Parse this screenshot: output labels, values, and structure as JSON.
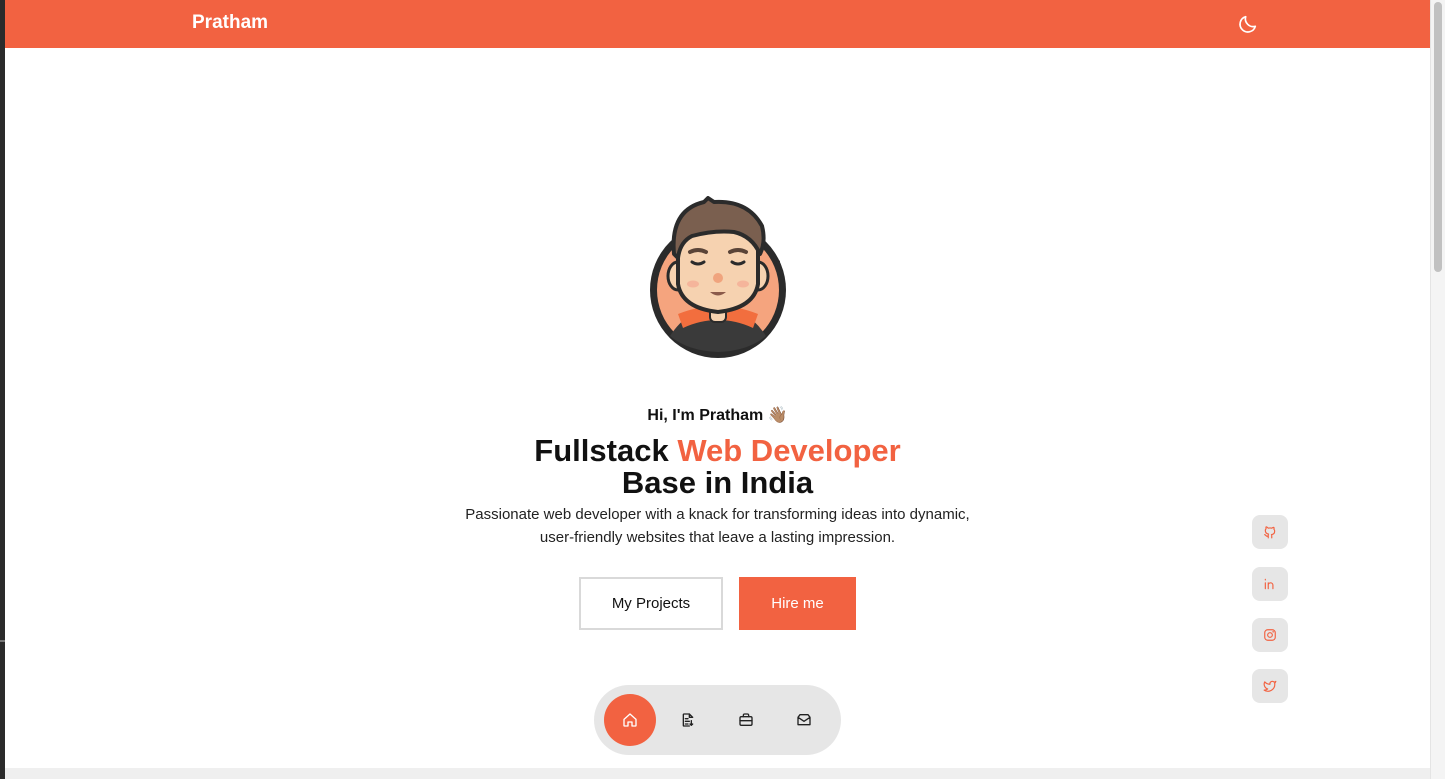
{
  "nav": {
    "brand": "Pratham",
    "theme_toggle_icon": "moon-icon"
  },
  "hero": {
    "greeting": "Hi, I'm Pratham 👋🏽",
    "headline_part1": "Fullstack",
    "headline_accent": "Web Developer",
    "headline_part2": "Base in India",
    "subtitle_line1": "Passionate web developer with a knack for transforming ideas into dynamic,",
    "subtitle_line2": "user-friendly websites that leave a lasting impression.",
    "buttons": {
      "projects_label": "My Projects",
      "hire_label": "Hire me"
    }
  },
  "social_links": [
    {
      "icon": "github-icon"
    },
    {
      "icon": "linkedin-icon"
    },
    {
      "icon": "instagram-icon"
    },
    {
      "icon": "twitter-icon"
    }
  ],
  "dock": {
    "items": [
      {
        "icon": "home-icon",
        "active": true
      },
      {
        "icon": "document-icon",
        "active": false
      },
      {
        "icon": "briefcase-icon",
        "active": false
      },
      {
        "icon": "mail-icon",
        "active": false
      }
    ]
  },
  "colors": {
    "accent": "#f26241",
    "text": "#111111",
    "dock_bg": "#e6e6e6"
  }
}
